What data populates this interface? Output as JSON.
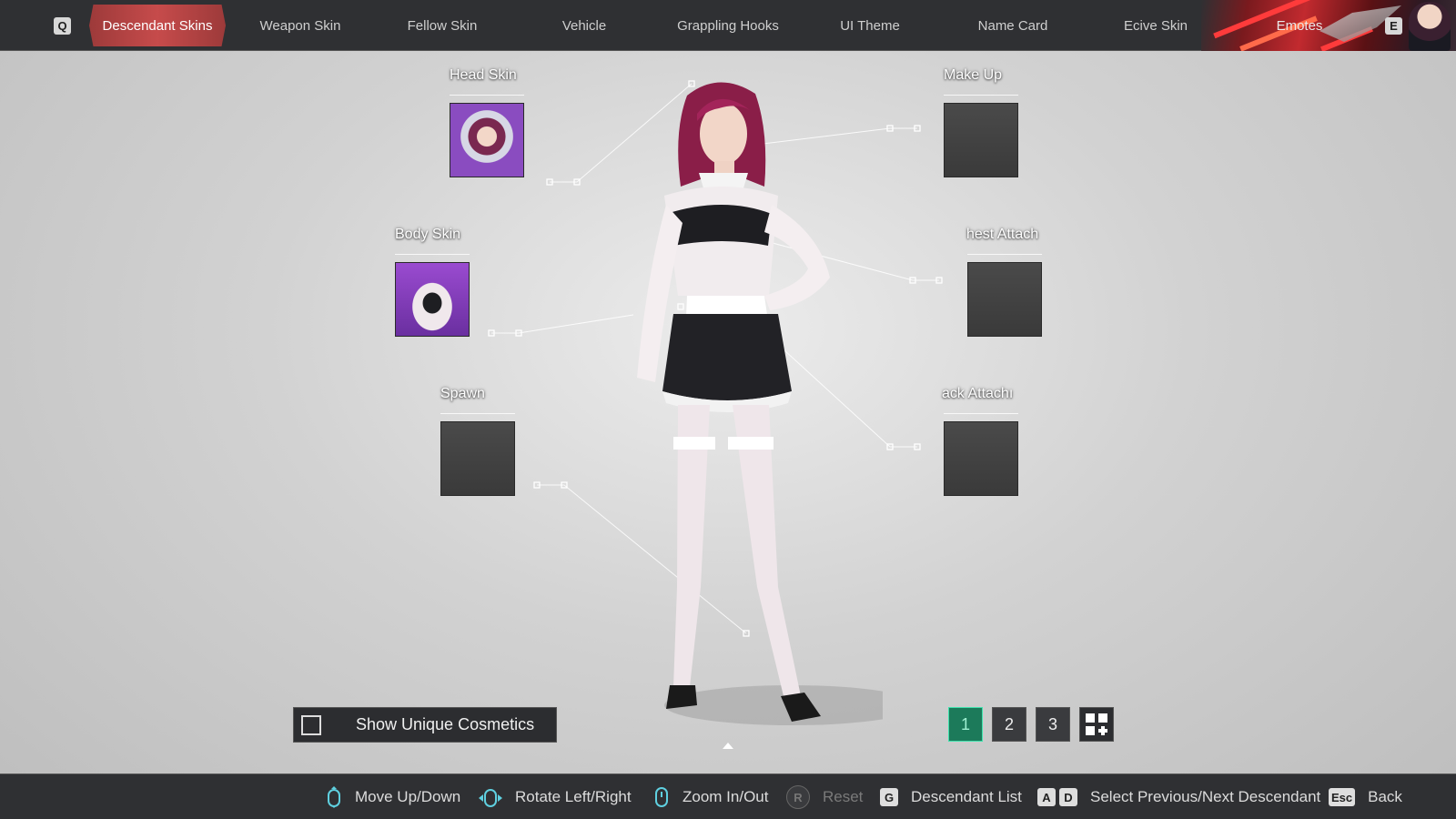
{
  "nav": {
    "left_key": "Q",
    "right_key": "E",
    "tabs": [
      {
        "label": "Descendant Skins",
        "active": true
      },
      {
        "label": "Weapon Skin",
        "active": false
      },
      {
        "label": "Fellow Skin",
        "active": false
      },
      {
        "label": "Vehicle",
        "active": false
      },
      {
        "label": "Grappling Hooks",
        "active": false
      },
      {
        "label": "UI Theme",
        "active": false
      },
      {
        "label": "Name Card",
        "active": false
      },
      {
        "label": "Ecive Skin",
        "active": false
      },
      {
        "label": "Emotes",
        "active": false
      }
    ],
    "accent": "#c64b4b"
  },
  "slots": {
    "head": {
      "label": "Head Skin"
    },
    "body": {
      "label": "Body Skin"
    },
    "spawn": {
      "label": "Spawn"
    },
    "makeup": {
      "label": "Make Up"
    },
    "chest": {
      "label": "hest Attach"
    },
    "back": {
      "label": "ack Attachı"
    }
  },
  "controls": {
    "unique_label": "Show Unique Cosmetics",
    "unique_checked": false,
    "presets": [
      "1",
      "2",
      "3"
    ],
    "active_preset": "1",
    "preset_active_color": "#3fe3ae"
  },
  "footer": {
    "move": "Move Up/Down",
    "rotate": "Rotate Left/Right",
    "zoom": "Zoom In/Out",
    "reset_key": "R",
    "reset": "Reset",
    "list_key": "G",
    "list": "Descendant List",
    "prev_key": "A",
    "next_key": "D",
    "select": "Select Previous/Next Descendant",
    "back_key": "Esc",
    "back": "Back"
  }
}
